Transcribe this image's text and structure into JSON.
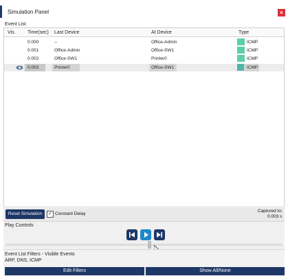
{
  "window": {
    "title": "Simulation Panel",
    "close_label": "×"
  },
  "event_list": {
    "label": "Event List",
    "columns": [
      "Vis.",
      "Time(sec)",
      "Last Device",
      "At Device",
      "Type"
    ],
    "rows": [
      {
        "vis": "",
        "time": "0.000",
        "last": "--",
        "at": "Office-Admin",
        "type": "ICMP"
      },
      {
        "vis": "",
        "time": "0.001",
        "last": "Office-Admin",
        "at": "Office-SW1",
        "type": "ICMP"
      },
      {
        "vis": "",
        "time": "0.002",
        "last": "Office-SW1",
        "at": "Printer0",
        "type": "ICMP"
      },
      {
        "vis": "eye-icon",
        "time": "0.003",
        "last": "Printer0",
        "at": "Office-SW1",
        "type": "ICMP"
      }
    ],
    "type_color": "#5ccfa7"
  },
  "controls": {
    "reset_label": "Reset Simulation",
    "constant_delay_label": "Constant Delay",
    "constant_delay_checked": true,
    "captured_label": "Captured to:",
    "captured_value": "0.003 s"
  },
  "play_controls": {
    "label": "Play Controls",
    "buttons": [
      "back-icon",
      "play-icon",
      "forward-icon"
    ]
  },
  "filters": {
    "label": "Event List Filters - Visible Events",
    "value": "ARP, DNS, ICMP",
    "edit_label": "Edit Filters",
    "show_label": "Show All/None"
  },
  "colors": {
    "accent": "#1d3766",
    "close": "#d9323a",
    "play_button": "#1e88c8"
  }
}
